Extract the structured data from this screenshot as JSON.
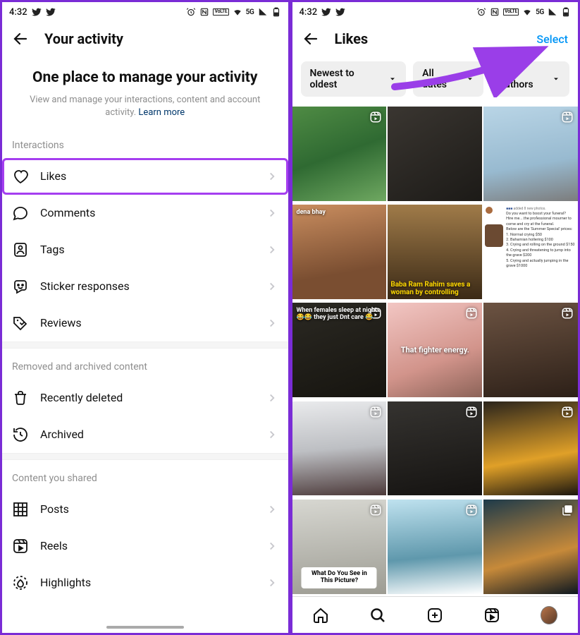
{
  "statusbar": {
    "time": "4:32",
    "network": "5G",
    "lte": "VoLTE"
  },
  "left": {
    "title": "Your activity",
    "intro_heading": "One place to manage your activity",
    "intro_sub": "View and manage your interactions, content and account activity. ",
    "intro_link": "Learn more",
    "sections": {
      "interactions": {
        "label": "Interactions",
        "items": [
          {
            "label": "Likes",
            "icon": "heart",
            "highlight": true
          },
          {
            "label": "Comments",
            "icon": "comment"
          },
          {
            "label": "Tags",
            "icon": "tag"
          },
          {
            "label": "Sticker responses",
            "icon": "sticker"
          },
          {
            "label": "Reviews",
            "icon": "review"
          }
        ]
      },
      "removed": {
        "label": "Removed and archived content",
        "items": [
          {
            "label": "Recently deleted",
            "icon": "trash"
          },
          {
            "label": "Archived",
            "icon": "archive"
          }
        ]
      },
      "shared": {
        "label": "Content you shared",
        "items": [
          {
            "label": "Posts",
            "icon": "grid"
          },
          {
            "label": "Reels",
            "icon": "reels"
          },
          {
            "label": "Highlights",
            "icon": "highlight"
          }
        ]
      }
    }
  },
  "right": {
    "title": "Likes",
    "select_label": "Select",
    "filters": [
      {
        "label": "Newest to oldest"
      },
      {
        "label": "All dates"
      },
      {
        "label": "All authors"
      }
    ],
    "tiles": [
      {
        "bg": "linear-gradient(160deg,#4f8b44 0%,#2f6a32 50%,#6fa861 100%)",
        "badge": "reel",
        "overlay": null
      },
      {
        "bg": "linear-gradient(150deg,#3a3631,#1c1a17)",
        "badge": null,
        "overlay": null
      },
      {
        "bg": "linear-gradient(170deg,#b9d5e6 0%,#98bad0 60%,#7c7c7c 100%)",
        "badge": "reel",
        "overlay": null
      },
      {
        "bg": "linear-gradient(170deg,#c98d5f 0%,#7a4e31 70%)",
        "badge": null,
        "overlay": {
          "cls": "ot-top",
          "text": "dena bhay"
        }
      },
      {
        "bg": "linear-gradient(180deg,#a07b49 0%,#3b2a16 100%)",
        "badge": null,
        "overlay": {
          "cls": "ot-bot",
          "text": "Baba Ram Rahim saves a woman by controlling",
          "color": "#ffd800"
        }
      },
      {
        "bg": "#ffffff",
        "badge": null,
        "overlay": null,
        "meme": true
      },
      {
        "bg": "linear-gradient(160deg,#2b2923,#16140f)",
        "badge": "reel",
        "overlay": {
          "cls": "ot-top",
          "text": "When females sleep at night 😂😂 they just Dnt care 😂"
        }
      },
      {
        "bg": "linear-gradient(160deg,#f2c6c3 0%,#d2948b 60%,#8c6358 100%)",
        "badge": "reel",
        "overlay": {
          "cls": "ot-mid",
          "text": "That fighter energy."
        }
      },
      {
        "bg": "linear-gradient(170deg,#6c5342 0%,#2d2018 100%)",
        "badge": "reel",
        "overlay": null
      },
      {
        "bg": "linear-gradient(175deg,#e9eaec 0%,#bdbfc3 50%,#4c3a3a 100%)",
        "badge": "reel",
        "overlay": null
      },
      {
        "bg": "linear-gradient(170deg,#353330 0%,#151311 100%)",
        "badge": "reel",
        "overlay": null
      },
      {
        "bg": "linear-gradient(170deg,#2a241c 0%,#e0a028 60%,#1b160f 100%)",
        "badge": "reel",
        "overlay": null
      },
      {
        "bg": "linear-gradient(175deg,#d7d7d1 0%,#9d9c93 100%)",
        "badge": "reel",
        "overlay": {
          "cls": "ot-box",
          "text": "What Do You See in This Picture?"
        }
      },
      {
        "bg": "linear-gradient(175deg,#bfe2ef 0%,#5f98ac 60%,#ffffff 100%)",
        "badge": "reel",
        "overlay": null
      },
      {
        "bg": "linear-gradient(165deg,#1d3a4a 0%,#c78a3a 60%,#0d1720 100%)",
        "badge": "multi",
        "overlay": null
      }
    ],
    "meme": {
      "header": "added 8 new photos.",
      "lines": [
        "Do you want to boost your funeral?",
        "Hire me....the professional mourner to come and cry at the funeral.",
        "Below are the 'Summer Special'  prices:",
        "1. Normal crying $50",
        "2. Bahamian hollering $100",
        "3. Crying and rolling on the ground $150",
        "4. Crying and threatening to jump into the grave $200",
        "5. Crying and actually jumping in the grave $1000"
      ]
    }
  }
}
